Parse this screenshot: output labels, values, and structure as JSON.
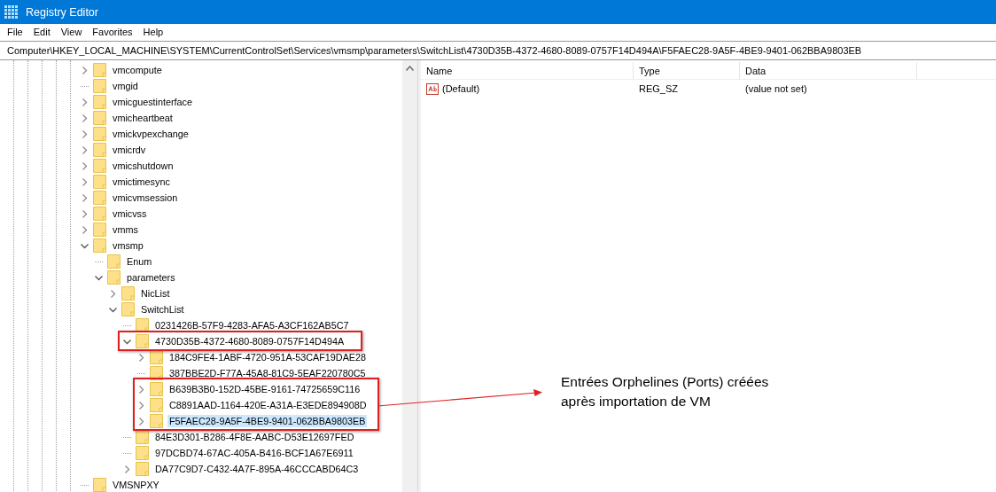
{
  "window": {
    "title": "Registry Editor"
  },
  "menu": [
    {
      "label": "File"
    },
    {
      "label": "Edit"
    },
    {
      "label": "View"
    },
    {
      "label": "Favorites"
    },
    {
      "label": "Help"
    }
  ],
  "address": "Computer\\HKEY_LOCAL_MACHINE\\SYSTEM\\CurrentControlSet\\Services\\vmsmp\\parameters\\SwitchList\\4730D35B-4372-4680-8089-0757F14D494A\\F5FAEC28-9A5F-4BE9-9401-062BBA9803EB",
  "tree": [
    {
      "name": "vmcompute",
      "expanded": false,
      "selected": false
    },
    {
      "name": "vmgid",
      "selected": false
    },
    {
      "name": "vmicguestinterface",
      "expanded": false,
      "selected": false
    },
    {
      "name": "vmicheartbeat",
      "expanded": false,
      "selected": false
    },
    {
      "name": "vmickvpexchange",
      "expanded": false,
      "selected": false
    },
    {
      "name": "vmicrdv",
      "expanded": false,
      "selected": false
    },
    {
      "name": "vmicshutdown",
      "expanded": false,
      "selected": false
    },
    {
      "name": "vmictimesync",
      "expanded": false,
      "selected": false
    },
    {
      "name": "vmicvmsession",
      "expanded": false,
      "selected": false
    },
    {
      "name": "vmicvss",
      "expanded": false,
      "selected": false
    },
    {
      "name": "vmms",
      "expanded": false,
      "selected": false
    },
    {
      "name": "vmsmp",
      "expanded": true,
      "selected": false,
      "children": [
        {
          "name": "Enum",
          "selected": false
        },
        {
          "name": "parameters",
          "expanded": true,
          "selected": false,
          "children": [
            {
              "name": "NicList",
              "expanded": false,
              "selected": false
            },
            {
              "name": "SwitchList",
              "expanded": true,
              "selected": false,
              "children": [
                {
                  "name": "0231426B-57F9-4283-AFA5-A3CF162AB5C7",
                  "selected": false
                },
                {
                  "name": "4730D35B-4372-4680-8089-0757F14D494A",
                  "expanded": true,
                  "selected": false,
                  "children": [
                    {
                      "name": "184C9FE4-1ABF-4720-951A-53CAF19DAE28",
                      "expanded": false,
                      "selected": false
                    },
                    {
                      "name": "387BBE2D-F77A-45A8-81C9-5EAF220780C5",
                      "selected": false
                    },
                    {
                      "name": "B639B3B0-152D-45BE-9161-74725659C116",
                      "expanded": false,
                      "selected": false
                    },
                    {
                      "name": "C8891AAD-1164-420E-A31A-E3EDE894908D",
                      "expanded": false,
                      "selected": false
                    },
                    {
                      "name": "F5FAEC28-9A5F-4BE9-9401-062BBA9803EB",
                      "expanded": false,
                      "selected": true
                    }
                  ]
                },
                {
                  "name": "84E3D301-B286-4F8E-AABC-D53E12697FED",
                  "selected": false
                },
                {
                  "name": "97DCBD74-67AC-405A-B416-BCF1A67E6911",
                  "selected": false
                },
                {
                  "name": "DA77C9D7-C432-4A7F-895A-46CCCABD64C3",
                  "expanded": false,
                  "selected": false
                }
              ]
            }
          ]
        }
      ]
    },
    {
      "name": "VMSNPXY",
      "selected": false
    }
  ],
  "values": {
    "columns": [
      "Name",
      "Type",
      "Data"
    ],
    "rows": [
      {
        "name": "(Default)",
        "type": "REG_SZ",
        "data": "(value not set)"
      }
    ]
  },
  "annotation": {
    "lines": [
      "Entrées Orphelines (Ports) créées",
      "après importation de VM"
    ]
  }
}
